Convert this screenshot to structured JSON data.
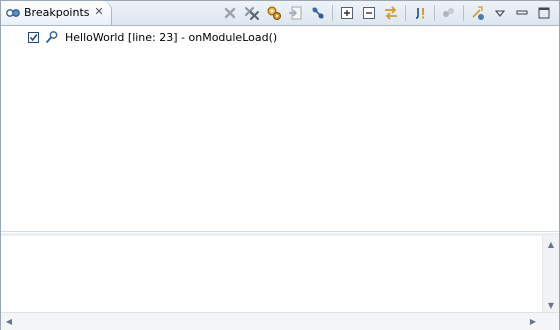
{
  "view": {
    "tab_label": "Breakpoints",
    "tab_icon": "breakpoints-view-icon",
    "close_icon": "close-icon",
    "accent": "#1c4b80"
  },
  "toolbar": {
    "buttons": [
      "remove-selected-breakpoints-icon",
      "remove-all-breakpoints-icon",
      "show-supported-breakpoints-icon",
      "go-to-file-icon",
      "skip-all-breakpoints-icon",
      "expand-all-icon",
      "collapse-all-icon",
      "link-with-debug-view-icon",
      "add-java-exception-breakpoint-icon",
      "group-by-icon",
      "new-breakpoint-icon",
      "view-menu-icon",
      "minimize-icon",
      "maximize-icon"
    ]
  },
  "breakpoints": [
    {
      "checked": true,
      "icon": "method-breakpoint-icon",
      "label": "HelloWorld [line: 23] - onModuleLoad()"
    }
  ],
  "detail_pane": {
    "text": ""
  }
}
